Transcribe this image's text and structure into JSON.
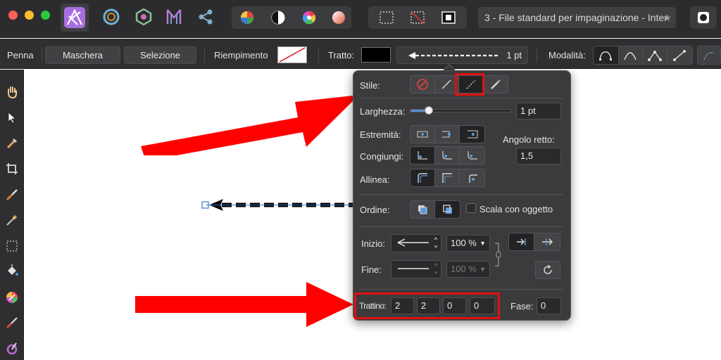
{
  "window": {
    "document_title": "3 - File standard per impaginazione - Inter",
    "traffic_colors": [
      "#ff5f57",
      "#febc2e",
      "#28c840"
    ],
    "accent": "#a86ee0"
  },
  "topbar": {
    "icons": [
      "affinity-publisher-icon",
      "designer-persona-icon",
      "photo-persona-icon",
      "publisher-persona-icon",
      "share-icon",
      "color-wheel-icon",
      "contrast-icon",
      "hue-icon",
      "gradient-icon",
      "select-rect-icon",
      "deselect-icon",
      "invert-selection-icon",
      "star-icon",
      "record-icon"
    ]
  },
  "context": {
    "tool_name": "Penna",
    "mask_button": "Maschera",
    "selection_button": "Selezione",
    "fill_label": "Riempimento",
    "stroke_label": "Tratto:",
    "stroke_width": "1 pt",
    "mode_label": "Modalità:"
  },
  "popover": {
    "style_label": "Stile:",
    "width_label": "Larghezza:",
    "width_value": "1 pt",
    "width_slider_level": 0.18,
    "caps_label": "Estremità:",
    "joins_label": "Congiungi:",
    "align_label": "Allinea:",
    "miter_label": "Angolo retto:",
    "miter_value": "1,5",
    "order_label": "Ordine:",
    "scale_label": "Scala con oggetto",
    "start_label": "Inizio:",
    "start_scale": "100 %",
    "end_label": "Fine:",
    "end_scale": "100 %",
    "dash_label": "Trattino:",
    "dash_values": [
      "2",
      "2",
      "0",
      "0"
    ],
    "phase_label": "Fase:",
    "phase_value": "0"
  },
  "annotations": {
    "arrow_color": "#ff0000",
    "box_color": "#e01010"
  }
}
